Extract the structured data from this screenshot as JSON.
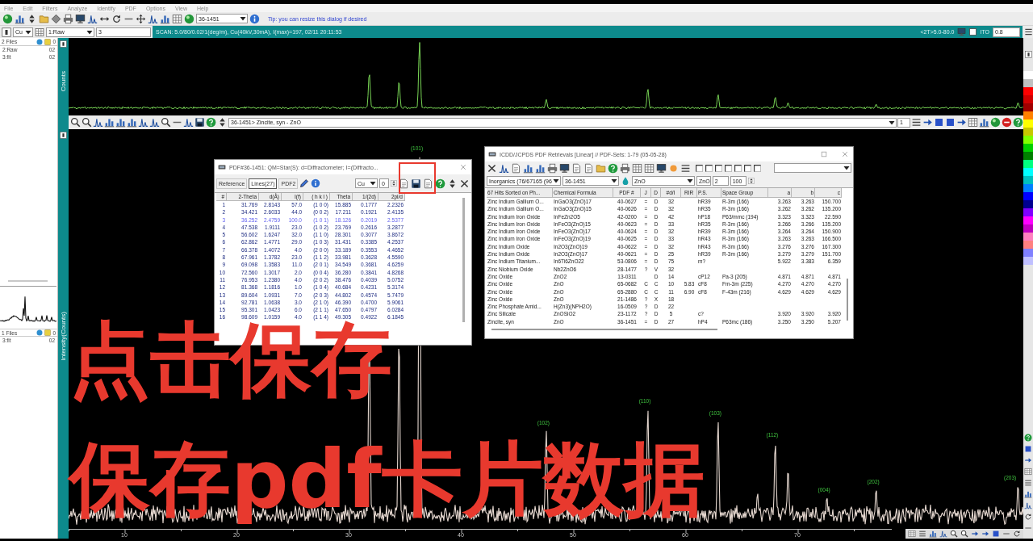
{
  "menu": [
    "File",
    "Edit",
    "Filters",
    "Analyze",
    "Identify",
    "PDF",
    "Options",
    "View",
    "Help"
  ],
  "toolbar": {
    "pdf_number": "36-1451",
    "tip": "Tip: you can resize this dialog if desired"
  },
  "scan_bar": {
    "radiation": "Cu",
    "pattern": "1:Raw",
    "field": "3",
    "scan_info": "SCAN: 5.0/80/0.02/1(deg/m), Cu(40kV,30mA), I(max)=197, 02/11 20:11:53",
    "range": "<2T>5.0-80.0",
    "option_checked": false,
    "option_label": "ITO",
    "value": "0.8"
  },
  "file_panel": {
    "upper": {
      "header": "2 Files",
      "badge": "0",
      "items": [
        {
          "name": "2:Raw",
          "value": "02"
        },
        {
          "name": "3:fit",
          "value": "02"
        }
      ]
    },
    "lower": {
      "header": "1 Files",
      "badge": "0",
      "items": [
        {
          "name": "3:fit",
          "value": "02"
        }
      ]
    }
  },
  "axis_titles": {
    "upper": "Counts",
    "lower": "Intensity(Counts)"
  },
  "overlay_bar": {
    "phase": "36-1451> Zincite, syn - ZnO",
    "field": "1"
  },
  "chart": {
    "peak_labels": [
      "(101)",
      "(102)",
      "(110)",
      "(103)",
      "(112)",
      "(004)",
      "(202)",
      "(203)"
    ],
    "x_ticks": [
      "10",
      "20",
      "30",
      "40",
      "50",
      "60",
      "70"
    ]
  },
  "palette": [
    {
      "color": "#ffffff"
    },
    {
      "color": "#c0c0c0"
    },
    {
      "color": "#ff0000"
    },
    {
      "color": "#d00000"
    },
    {
      "color": "#a00000"
    },
    {
      "color": "#ff8000"
    },
    {
      "color": "#ffff00"
    },
    {
      "color": "#c8c800"
    },
    {
      "color": "#80ff00"
    },
    {
      "color": "#00d000"
    },
    {
      "color": "#008000"
    },
    {
      "color": "#00ff80"
    },
    {
      "color": "#00ffff"
    },
    {
      "color": "#00c0c0"
    },
    {
      "color": "#0080ff"
    },
    {
      "color": "#0000ff"
    },
    {
      "color": "#000090"
    },
    {
      "color": "#8000ff"
    },
    {
      "color": "#ff00ff"
    },
    {
      "color": "#c000c0"
    },
    {
      "color": "#ff80c0"
    },
    {
      "color": "#ff8080"
    },
    {
      "color": "#8080ff"
    },
    {
      "color": "#c0c0ff"
    }
  ],
  "pdf_card": {
    "title": "PDF#36-1451: QM=Star(S): d=Diffractometer; I=(Diffracto...",
    "tabs": [
      {
        "label": "Reference",
        "selected": false
      },
      {
        "label": "Lines(27)",
        "selected": true
      },
      {
        "label": "PDF2",
        "selected": false
      }
    ],
    "radiation": "Cu",
    "field": "0",
    "columns": [
      "#",
      "2-Theta",
      "d(Å)",
      "I(f)",
      "( h k l )",
      "Theta",
      "1/(2d)",
      "2pi/d"
    ],
    "rows": [
      {
        "cells": [
          "1",
          "31.769",
          "2.8143",
          "57.0",
          "(1 0 0)",
          "15.885",
          "0.1777",
          "2.2326"
        ],
        "highlighted": false
      },
      {
        "cells": [
          "2",
          "34.421",
          "2.6033",
          "44.0",
          "(0 0 2)",
          "17.211",
          "0.1921",
          "2.4135"
        ],
        "highlighted": false
      },
      {
        "cells": [
          "3",
          "36.252",
          "2.4759",
          "100.0",
          "(1 0 1)",
          "18.126",
          "0.2019",
          "2.5377"
        ],
        "highlighted": true
      },
      {
        "cells": [
          "4",
          "47.538",
          "1.9111",
          "23.0",
          "(1 0 2)",
          "23.769",
          "0.2616",
          "3.2877"
        ],
        "highlighted": false
      },
      {
        "cells": [
          "5",
          "56.602",
          "1.6247",
          "32.0",
          "(1 1 0)",
          "28.301",
          "0.3077",
          "3.8672"
        ],
        "highlighted": false
      },
      {
        "cells": [
          "6",
          "62.862",
          "1.4771",
          "29.0",
          "(1 0 3)",
          "31.431",
          "0.3385",
          "4.2537"
        ],
        "highlighted": false
      },
      {
        "cells": [
          "7",
          "66.378",
          "1.4072",
          "4.0",
          "(2 0 0)",
          "33.189",
          "0.3553",
          "4.4652"
        ],
        "highlighted": false
      },
      {
        "cells": [
          "8",
          "67.961",
          "1.3782",
          "23.0",
          "(1 1 2)",
          "33.981",
          "0.3628",
          "4.5590"
        ],
        "highlighted": false
      },
      {
        "cells": [
          "9",
          "69.098",
          "1.3583",
          "11.0",
          "(2 0 1)",
          "34.549",
          "0.3681",
          "4.6259"
        ],
        "highlighted": false
      },
      {
        "cells": [
          "10",
          "72.560",
          "1.3017",
          "2.0",
          "(0 0 4)",
          "36.280",
          "0.3841",
          "4.8268"
        ],
        "highlighted": false
      },
      {
        "cells": [
          "11",
          "76.953",
          "1.2380",
          "4.0",
          "(2 0 2)",
          "38.476",
          "0.4039",
          "5.0752"
        ],
        "highlighted": false
      },
      {
        "cells": [
          "12",
          "81.368",
          "1.1816",
          "1.0",
          "(1 0 4)",
          "40.684",
          "0.4231",
          "5.3174"
        ],
        "highlighted": false
      },
      {
        "cells": [
          "13",
          "89.604",
          "1.0931",
          "7.0",
          "(2 0 3)",
          "44.802",
          "0.4574",
          "5.7479"
        ],
        "highlighted": false
      },
      {
        "cells": [
          "14",
          "92.781",
          "1.0638",
          "3.0",
          "(2 1 0)",
          "46.390",
          "0.4700",
          "5.9061"
        ],
        "highlighted": false
      },
      {
        "cells": [
          "15",
          "95.301",
          "1.0423",
          "6.0",
          "(2 1 1)",
          "47.650",
          "0.4797",
          "6.0284"
        ],
        "highlighted": false
      },
      {
        "cells": [
          "16",
          "98.609",
          "1.0159",
          "4.0",
          "(1 1 4)",
          "49.305",
          "0.4922",
          "6.1845"
        ],
        "highlighted": false
      }
    ]
  },
  "pdf_search": {
    "title": "ICDD/JCPDS PDF Retrievals [Linear] // PDF-Sets: 1-79 (05-05-28)",
    "filters": [
      {
        "checked": false
      },
      {
        "checked": false
      },
      {
        "checked": false
      },
      {
        "checked": false
      },
      {
        "checked": false
      },
      {
        "checked": false
      },
      {
        "checked": false
      }
    ],
    "database": "Inorganics (76/67165 (96",
    "pdf_number": "36-1451",
    "element": "ZnO",
    "formula": "ZnO",
    "min": "2",
    "max": "100",
    "columns": [
      "67 Hits Sorted on Ph...",
      "Chemical Formula",
      "PDF #",
      "J",
      "D",
      "#d/I",
      "RIR",
      "P.S.",
      "Space Group",
      "a",
      "b",
      "c"
    ],
    "rows": [
      {
        "hit": "Zinc Indium Gallium O...",
        "formula": "InGaO3(ZnO)17",
        "pdf": "40-0627",
        "j": "=",
        "d": "D",
        "lines": "32",
        "ps": "hR39",
        "space_group": "R-3m (166)",
        "a": "3.263",
        "b": "3.263",
        "c": "150.700"
      },
      {
        "hit": "Zinc Indium Gallium O...",
        "formula": "InGaO3(ZnO)15",
        "pdf": "40-0626",
        "j": "=",
        "d": "D",
        "lines": "32",
        "ps": "hR35",
        "space_group": "R-3m (166)",
        "a": "3.262",
        "b": "3.262",
        "c": "135.200"
      },
      {
        "hit": "Zinc Indium Iron Oxide",
        "formula": "InFeZn2O5",
        "pdf": "42-0200",
        "j": "=",
        "d": "D",
        "lines": "42",
        "ps": "hP18",
        "space_group": "P63/mmc (194)",
        "a": "3.323",
        "b": "3.323",
        "c": "22.590"
      },
      {
        "hit": "Zinc Indium Iron Oxide",
        "formula": "InFeO3(ZnO)15",
        "pdf": "40-0623",
        "j": "=",
        "d": "D",
        "lines": "33",
        "ps": "hR35",
        "space_group": "R-3m (166)",
        "a": "3.266",
        "b": "3.266",
        "c": "135.200"
      },
      {
        "hit": "Zinc Indium Iron Oxide",
        "formula": "InFeO3(ZnO)17",
        "pdf": "40-0624",
        "j": "=",
        "d": "D",
        "lines": "32",
        "ps": "hR39",
        "space_group": "R-3m (166)",
        "a": "3.264",
        "b": "3.264",
        "c": "150.900"
      },
      {
        "hit": "Zinc Indium Iron Oxide",
        "formula": "InFeO3(ZnO)19",
        "pdf": "40-0625",
        "j": "=",
        "d": "D",
        "lines": "33",
        "ps": "hR43",
        "space_group": "R-3m (166)",
        "a": "3.263",
        "b": "3.263",
        "c": "166.500"
      },
      {
        "hit": "Zinc Indium Oxide",
        "formula": "In2O3(ZnO)19",
        "pdf": "40-0622",
        "j": "=",
        "d": "D",
        "lines": "32",
        "ps": "hR43",
        "space_group": "R-3m (166)",
        "a": "3.276",
        "b": "3.276",
        "c": "167.300"
      },
      {
        "hit": "Zinc Indium Oxide",
        "formula": "In2O3(ZnO)17",
        "pdf": "40-0621",
        "j": "=",
        "d": "D",
        "lines": "25",
        "ps": "hR39",
        "space_group": "R-3m (166)",
        "a": "3.279",
        "b": "3.279",
        "c": "151.700"
      },
      {
        "hit": "Zinc Indium Titanium...",
        "formula": "In6Ti6ZnO22",
        "pdf": "53-0806",
        "j": "=",
        "d": "D",
        "lines": "75",
        "ps": "m?",
        "a": "5.922",
        "b": "3.383",
        "c": "6.359"
      },
      {
        "hit": "Zinc Niobium Oxide",
        "formula": "Nb2ZnO6",
        "pdf": "28-1477",
        "j": "?",
        "d": "V",
        "lines": "32"
      },
      {
        "hit": "Zinc Oxide",
        "formula": "ZnO2",
        "pdf": "13-0311",
        "d": "D",
        "lines": "14",
        "ps": "cP12",
        "space_group": "Pa-3 (205)",
        "a": "4.871",
        "b": "4.871",
        "c": "4.871"
      },
      {
        "hit": "Zinc Oxide",
        "formula": "ZnO",
        "pdf": "65-0682",
        "j": "C",
        "d": "C",
        "lines": "10",
        "rir": "5.83",
        "ps": "cF8",
        "space_group": "Fm-3m (225)",
        "a": "4.270",
        "b": "4.270",
        "c": "4.270"
      },
      {
        "hit": "Zinc Oxide",
        "formula": "ZnO",
        "pdf": "65-2880",
        "j": "C",
        "d": "C",
        "lines": "11",
        "rir": "6.90",
        "ps": "cF8",
        "space_group": "F-43m (216)",
        "a": "4.629",
        "b": "4.629",
        "c": "4.629"
      },
      {
        "hit": "Zinc Oxide",
        "formula": "ZnO",
        "pdf": "21-1486",
        "j": "?",
        "d": "X",
        "lines": "18"
      },
      {
        "hit": "Zinc Phosphate Amid...",
        "formula": "H(Zn3)(NPH2O)",
        "pdf": "16-0509",
        "j": "?",
        "d": "D",
        "lines": "22"
      },
      {
        "hit": "Zinc Silicate",
        "formula": "ZnOSiO2",
        "pdf": "23-1172",
        "j": "?",
        "d": "D",
        "lines": "5",
        "ps": "c?",
        "a": "3.920",
        "b": "3.920",
        "c": "3.920"
      },
      {
        "hit": "Zincite, syn",
        "formula": "ZnO",
        "pdf": "36-1451",
        "j": "=",
        "d": "D",
        "lines": "27",
        "ps": "hP4",
        "space_group": "P63mc (186)",
        "a": "3.250",
        "b": "3.250",
        "c": "5.207"
      }
    ]
  },
  "annotation": {
    "lines": [
      "点击保存",
      "保存pdf卡片数据"
    ]
  }
}
